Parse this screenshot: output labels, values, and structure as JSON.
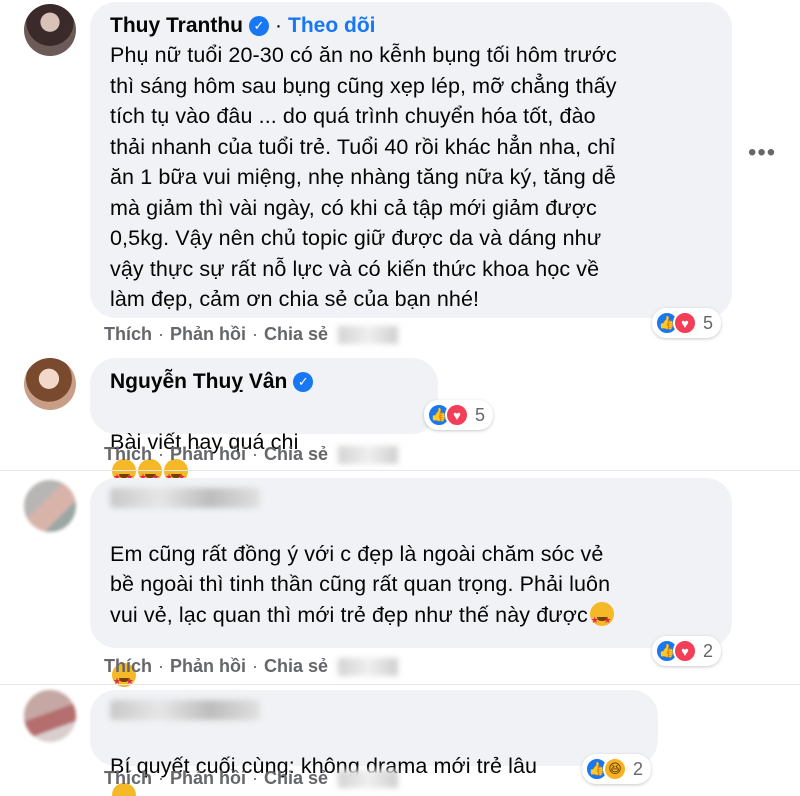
{
  "comments": [
    {
      "author": "Thuy Tranthu",
      "follow_label": "Theo dõi",
      "text": "Phụ nữ tuổi 20-30 có ăn no kễnh bụng tối hôm trước\nthì sáng hôm sau bụng cũng xẹp lép, mỡ chẳng thấy\ntích tụ vào đâu ... do quá trình chuyển hóa tốt, đào\nthải nhanh của tuổi trẻ. Tuổi 40 rồi khác hẳn nha, chỉ\năn 1 bữa vui miệng, nhẹ nhàng tăng nữa ký, tăng dễ\nmà giảm thì vài ngày, có khi cả tập mới giảm được\n0,5kg. Vậy nên chủ topic giữ được da và dáng như\nvậy thực sự rất nỗ lực và có kiến thức khoa học về\nlàm đẹp, cảm ơn chia sẻ của bạn nhé!",
      "reaction_count": "5"
    },
    {
      "author": "Nguyễn Thuỵ Vân",
      "text": "Bài viết hay quá chị",
      "reaction_count": "5"
    },
    {
      "text": "Em cũng rất đồng ý với c đẹp là ngoài chăm sóc vẻ\nbề ngoài thì tinh thần cũng rất quan trọng. Phải luôn\nvui vẻ, lạc quan thì mới trẻ đẹp như thế này được",
      "reaction_count": "2"
    },
    {
      "text": "Bí quyết cuối cùng: không drama mới trẻ lâu",
      "reaction_count": "2"
    }
  ],
  "actions": {
    "like": "Thích",
    "reply": "Phản hồi",
    "share": "Chia sẻ",
    "separator": "·"
  },
  "colors": {
    "bubble": "#f0f2f5",
    "link_blue": "#1877f2",
    "muted": "#65676b"
  }
}
